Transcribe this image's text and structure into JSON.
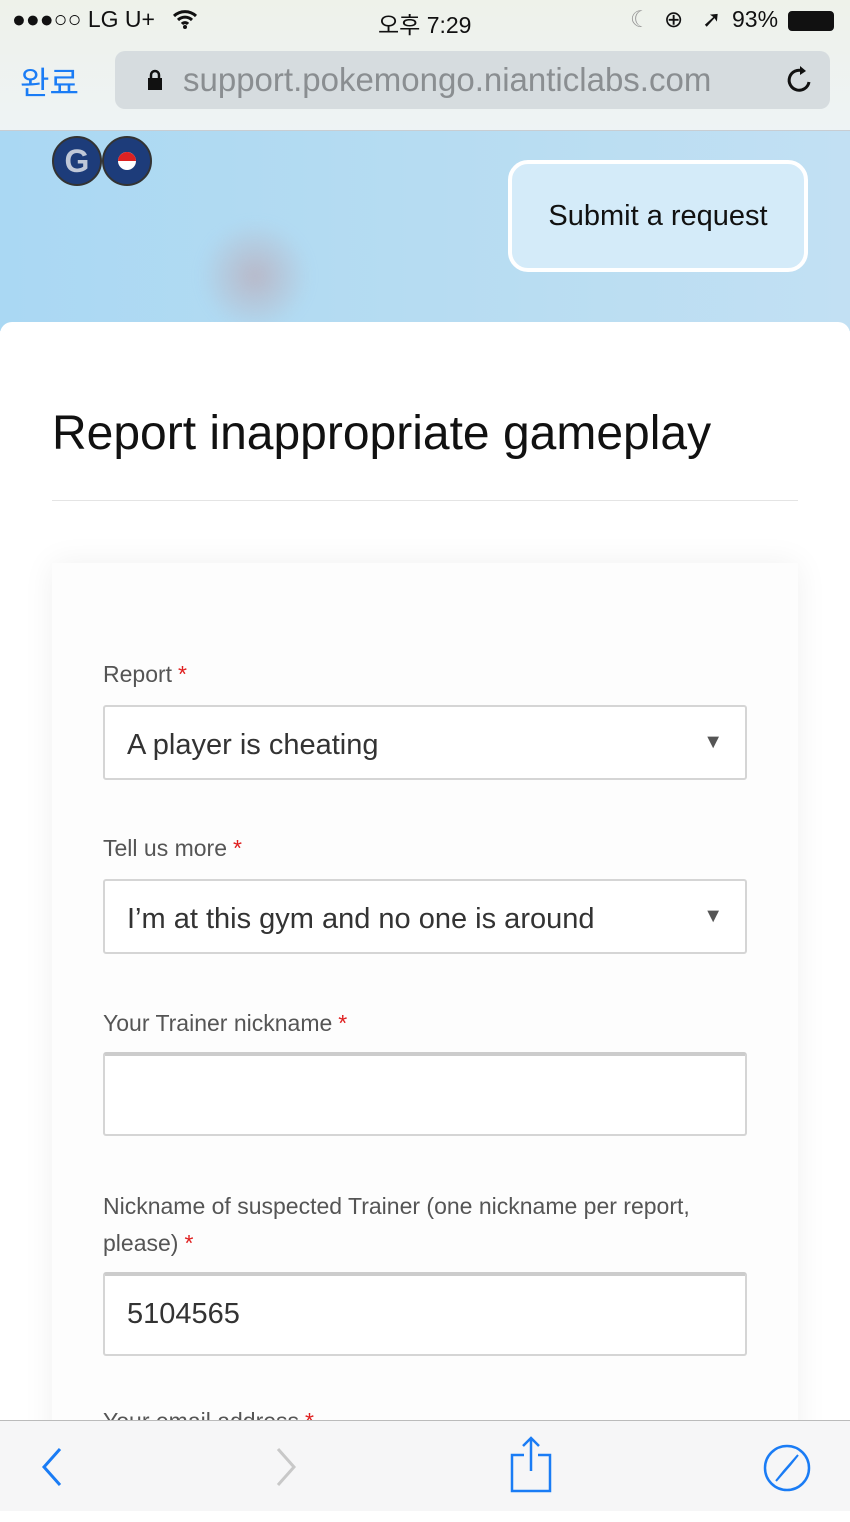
{
  "status_bar": {
    "carrier": "●●●○○ LG U+",
    "time": "오후 7:29",
    "battery": "93%"
  },
  "browser": {
    "done_label": "완료",
    "url": "support.pokemongo.nianticlabs.com"
  },
  "header": {
    "submit_label": "Submit a request",
    "logo": "Pokémon GO"
  },
  "page": {
    "title": "Report inappropriate gameplay"
  },
  "form": {
    "report": {
      "label": "Report",
      "required": "*",
      "value": "A player is cheating"
    },
    "tell_more": {
      "label": "Tell us more",
      "required": "*",
      "value": "I’m at this gym and no one is around"
    },
    "trainer_nickname": {
      "label": "Your Trainer nickname",
      "required": "*",
      "value": ""
    },
    "suspect_nickname": {
      "label": "Nickname of suspected Trainer (one nickname per report, please)",
      "required": "*",
      "value": "5104565"
    },
    "email": {
      "label": "Your email address",
      "required": "*"
    }
  },
  "colors": {
    "accent": "#1a7cf5",
    "required": "#e02020"
  }
}
